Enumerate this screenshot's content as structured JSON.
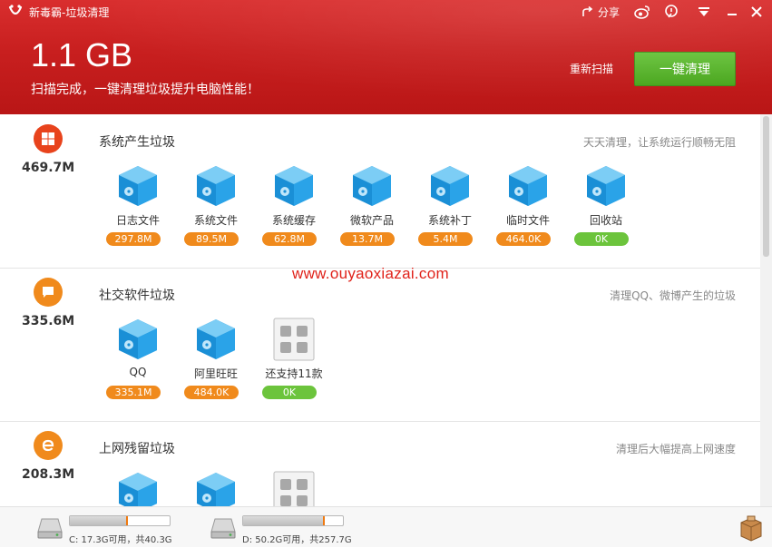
{
  "app": {
    "title": "新毒霸-垃圾清理"
  },
  "titlebar": {
    "share_label": "分享"
  },
  "summary": {
    "total_size": "1.1 GB",
    "message": "扫描完成，一键清理垃圾提升电脑性能！",
    "rescan_label": "重新扫描",
    "clean_button_label": "一键清理"
  },
  "sections": [
    {
      "title": "系统产生垃圾",
      "size": "469.7M",
      "description": "天天清理，让系统运行顺畅无阻",
      "icon": "windows-icon",
      "items": [
        {
          "label": "日志文件",
          "size": "297.8M",
          "badge_color": "orange"
        },
        {
          "label": "系统文件",
          "size": "89.5M",
          "badge_color": "orange"
        },
        {
          "label": "系统缓存",
          "size": "62.8M",
          "badge_color": "orange"
        },
        {
          "label": "微软产品",
          "size": "13.7M",
          "badge_color": "orange"
        },
        {
          "label": "系统补丁",
          "size": "5.4M",
          "badge_color": "orange"
        },
        {
          "label": "临时文件",
          "size": "464.0K",
          "badge_color": "orange"
        },
        {
          "label": "回收站",
          "size": "0K",
          "badge_color": "green"
        }
      ]
    },
    {
      "title": "社交软件垃圾",
      "size": "335.6M",
      "description": "清理QQ、微博产生的垃圾",
      "icon": "chat-icon",
      "items": [
        {
          "label": "QQ",
          "size": "335.1M",
          "badge_color": "orange"
        },
        {
          "label": "阿里旺旺",
          "size": "484.0K",
          "badge_color": "orange"
        },
        {
          "label": "还支持11款",
          "size": "0K",
          "badge_color": "green",
          "kind": "more"
        }
      ]
    },
    {
      "title": "上网残留垃圾",
      "size": "208.3M",
      "description": "清理后大幅提高上网速度",
      "icon": "browser-ie-icon",
      "items": [
        {
          "label": "",
          "size": ""
        },
        {
          "label": "",
          "size": ""
        },
        {
          "label": "",
          "size": "",
          "kind": "more"
        }
      ]
    }
  ],
  "watermark": "www.ouyaoxiazai.com",
  "disks": [
    {
      "label": "C: 17.3G可用，共40.3G",
      "used_fraction": 0.57
    },
    {
      "label": "D: 50.2G可用，共257.7G",
      "used_fraction": 0.81
    }
  ],
  "colors": {
    "header_red": "#c81f1f",
    "clean_green": "#4aa61e",
    "badge_orange": "#f08a1c",
    "badge_green": "#6cc43c",
    "windows_icon_bg": "#e8431c",
    "social_icon_bg": "#f08a1c",
    "browser_icon_bg": "#f08a1c"
  }
}
